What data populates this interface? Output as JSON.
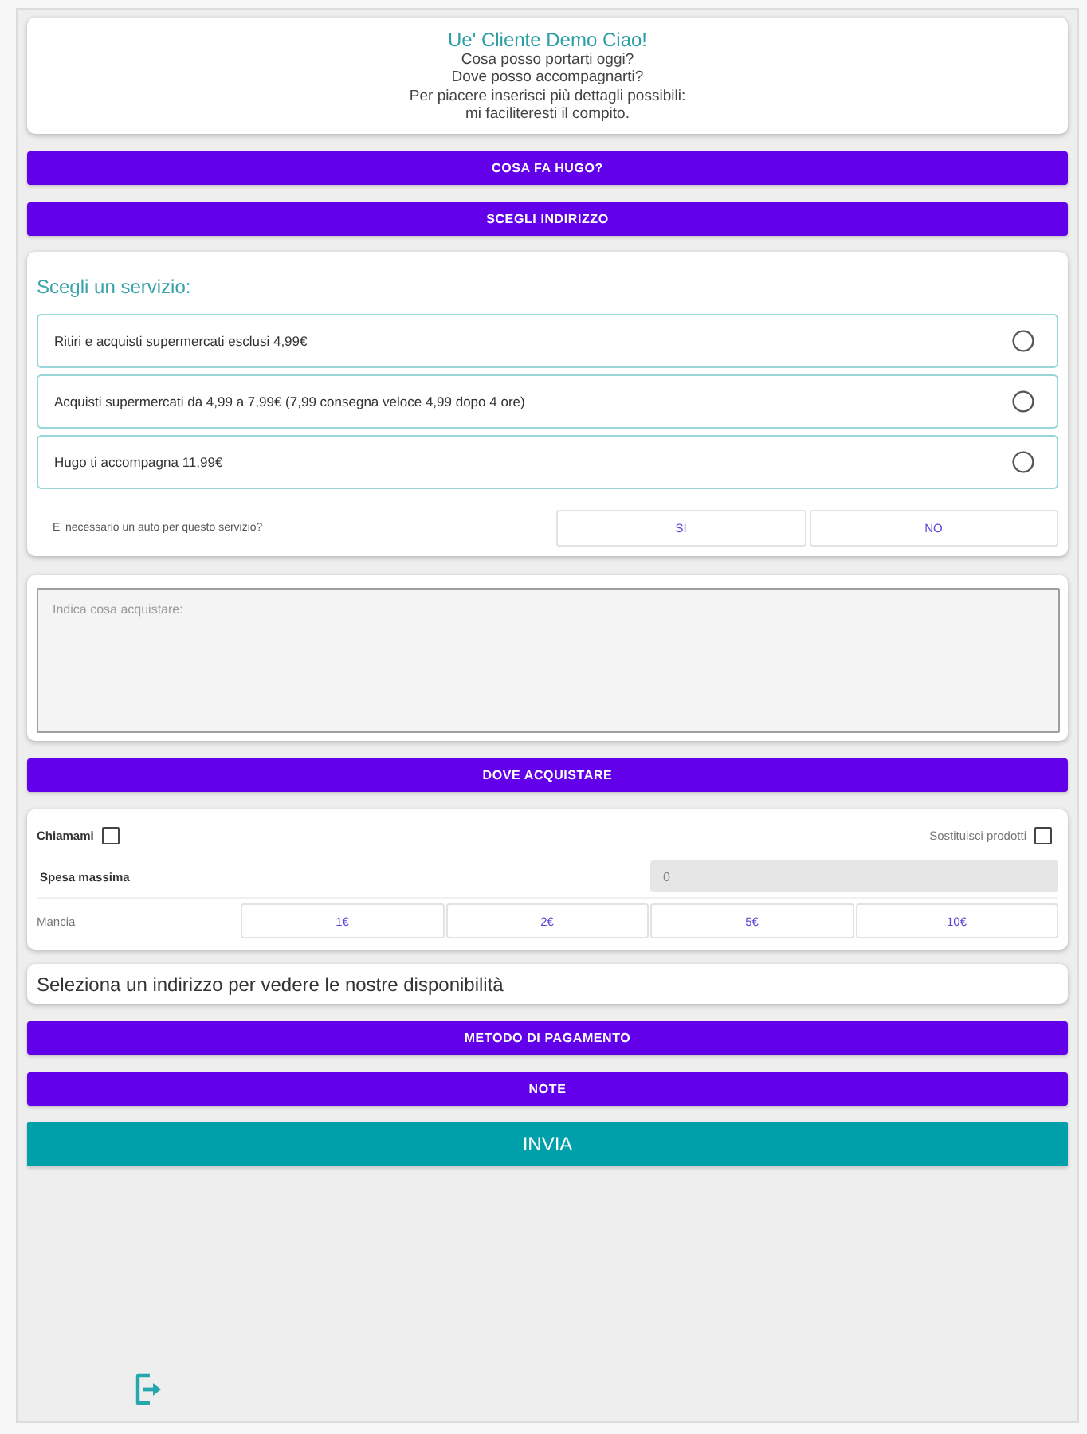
{
  "greeting": {
    "title": "Ue' Cliente Demo Ciao!",
    "lines": [
      "Cosa posso portarti oggi?",
      "Dove posso accompagnarti?",
      "Per piacere inserisci più dettagli possibili:",
      "mi faciliteresti il compito."
    ]
  },
  "top_buttons": [
    {
      "label": "COSA FA HUGO?"
    },
    {
      "label": "SCEGLI INDIRIZZO"
    }
  ],
  "service": {
    "heading": "Scegli un servizio:",
    "options": [
      {
        "label": "Ritiri e acquisti supermercati esclusi 4,99€",
        "selected": false
      },
      {
        "label": "Acquisti supermercati da 4,99 a 7,99€ (7,99 consegna veloce 4,99 dopo 4 ore)",
        "selected": false
      },
      {
        "label": "Hugo ti accompagna 11,99€",
        "selected": false
      }
    ],
    "car_question": {
      "label": "E' necessario un auto per questo servizio?",
      "choices": [
        {
          "label": "SI",
          "selected": false
        },
        {
          "label": "NO",
          "selected": false
        }
      ]
    }
  },
  "request": {
    "placeholder": "Indica cosa acquistare:"
  },
  "shop_button": {
    "label": "DOVE ACQUISTARE"
  },
  "options": {
    "call_me": {
      "label": "Chiamami",
      "checked": false
    },
    "substitute": {
      "label": "Sostituisci prodotti",
      "checked": false
    },
    "max_spend": {
      "label": "Spesa massima",
      "value": "0"
    },
    "tip": {
      "label": "Mancia",
      "choices": [
        {
          "label": "1€",
          "selected": false
        },
        {
          "label": "2€",
          "selected": false
        },
        {
          "label": "5€",
          "selected": false
        },
        {
          "label": "10€",
          "selected": false
        }
      ]
    }
  },
  "notice": "Seleziona un indirizzo per vedere le nostre disponibilità",
  "bottom_buttons": [
    {
      "label": "METODO DI PAGAMENTO"
    },
    {
      "label": "NOTE"
    }
  ],
  "submit": {
    "label": "INVIA"
  }
}
